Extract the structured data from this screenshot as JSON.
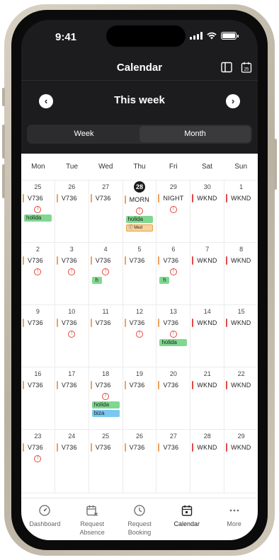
{
  "status": {
    "time": "9:41"
  },
  "header": {
    "title": "Calendar"
  },
  "week_nav": {
    "title": "This week"
  },
  "segment": {
    "left": "Week",
    "right": "Month"
  },
  "days": [
    "Mon",
    "Tue",
    "Wed",
    "Thu",
    "Fri",
    "Sat",
    "Sun"
  ],
  "weeks": [
    [
      {
        "num": "25",
        "shift": "V736",
        "color": "#f0a25c",
        "warn": true,
        "tags": [
          {
            "text": "holida",
            "type": "green"
          }
        ]
      },
      {
        "num": "26",
        "shift": "V736",
        "color": "#f0a25c"
      },
      {
        "num": "27",
        "shift": "V736",
        "color": "#f0a25c"
      },
      {
        "num": "28",
        "today": true,
        "shift": "MORN",
        "color": "#f0a25c",
        "warn": true,
        "tags": [
          {
            "text": "holida",
            "type": "green"
          },
          {
            "text": "ⓘ Med",
            "type": "med"
          }
        ]
      },
      {
        "num": "29",
        "shift": "NIGHT",
        "color": "#f0a25c",
        "warn": true
      },
      {
        "num": "30",
        "shift": "WKND",
        "color": "#e24a48"
      },
      {
        "num": "1",
        "shift": "WKND",
        "color": "#e24a48"
      }
    ],
    [
      {
        "num": "2",
        "shift": "V736",
        "color": "#f0a25c",
        "warn": true
      },
      {
        "num": "3",
        "shift": "V736",
        "color": "#f0a25c",
        "warn": true
      },
      {
        "num": "4",
        "shift": "V736",
        "color": "#f0a25c",
        "warn": true,
        "tags": [
          {
            "text": "h",
            "type": "green small"
          }
        ]
      },
      {
        "num": "5",
        "shift": "V736",
        "color": "#f0a25c"
      },
      {
        "num": "6",
        "shift": "V736",
        "color": "#f0a25c",
        "warn": true,
        "tags": [
          {
            "text": "h",
            "type": "green small"
          }
        ]
      },
      {
        "num": "7",
        "shift": "WKND",
        "color": "#e24a48"
      },
      {
        "num": "8",
        "shift": "WKND",
        "color": "#e24a48"
      }
    ],
    [
      {
        "num": "9",
        "shift": "V736",
        "color": "#f0a25c"
      },
      {
        "num": "10",
        "shift": "V736",
        "color": "#f0a25c",
        "warn": true
      },
      {
        "num": "11",
        "shift": "V736",
        "color": "#f0a25c"
      },
      {
        "num": "12",
        "shift": "V736",
        "color": "#f0a25c",
        "warn": true
      },
      {
        "num": "13",
        "shift": "V736",
        "color": "#f0a25c",
        "warn": true,
        "tags": [
          {
            "text": "holida",
            "type": "green"
          }
        ]
      },
      {
        "num": "14",
        "shift": "WKND",
        "color": "#e24a48"
      },
      {
        "num": "15",
        "shift": "WKND",
        "color": "#e24a48"
      }
    ],
    [
      {
        "num": "16",
        "shift": "V736",
        "color": "#f0a25c"
      },
      {
        "num": "17",
        "shift": "V736",
        "color": "#f0a25c"
      },
      {
        "num": "18",
        "shift": "V736",
        "color": "#f0a25c",
        "warn": true,
        "tags": [
          {
            "text": "holida",
            "type": "green"
          },
          {
            "text": "biza",
            "type": "blue"
          }
        ]
      },
      {
        "num": "19",
        "shift": "V736",
        "color": "#f0a25c"
      },
      {
        "num": "20",
        "shift": "V736",
        "color": "#f0a25c"
      },
      {
        "num": "21",
        "shift": "WKND",
        "color": "#e24a48"
      },
      {
        "num": "22",
        "shift": "WKND",
        "color": "#e24a48"
      }
    ],
    [
      {
        "num": "23",
        "shift": "V736",
        "color": "#f0a25c",
        "warn": true
      },
      {
        "num": "24",
        "shift": "V736",
        "color": "#f0a25c"
      },
      {
        "num": "25",
        "shift": "V736",
        "color": "#f0a25c"
      },
      {
        "num": "26",
        "shift": "V736",
        "color": "#f0a25c"
      },
      {
        "num": "27",
        "shift": "V736",
        "color": "#f0a25c"
      },
      {
        "num": "28",
        "shift": "WKND",
        "color": "#e24a48"
      },
      {
        "num": "29",
        "shift": "WKND",
        "color": "#e24a48"
      }
    ]
  ],
  "tabs": [
    {
      "label": "Dashboard",
      "icon": "dashboard-icon"
    },
    {
      "label": "Request\nAbsence",
      "icon": "calendar-x-icon"
    },
    {
      "label": "Request\nBooking",
      "icon": "clock-icon"
    },
    {
      "label": "Calendar",
      "icon": "calendar-icon",
      "active": true
    },
    {
      "label": "More",
      "icon": "more-icon"
    }
  ],
  "colors": {
    "day_shift": "#f0a25c",
    "weekend_shift": "#e24a48",
    "holiday": "#7fd88f",
    "biza": "#79c8f0"
  }
}
